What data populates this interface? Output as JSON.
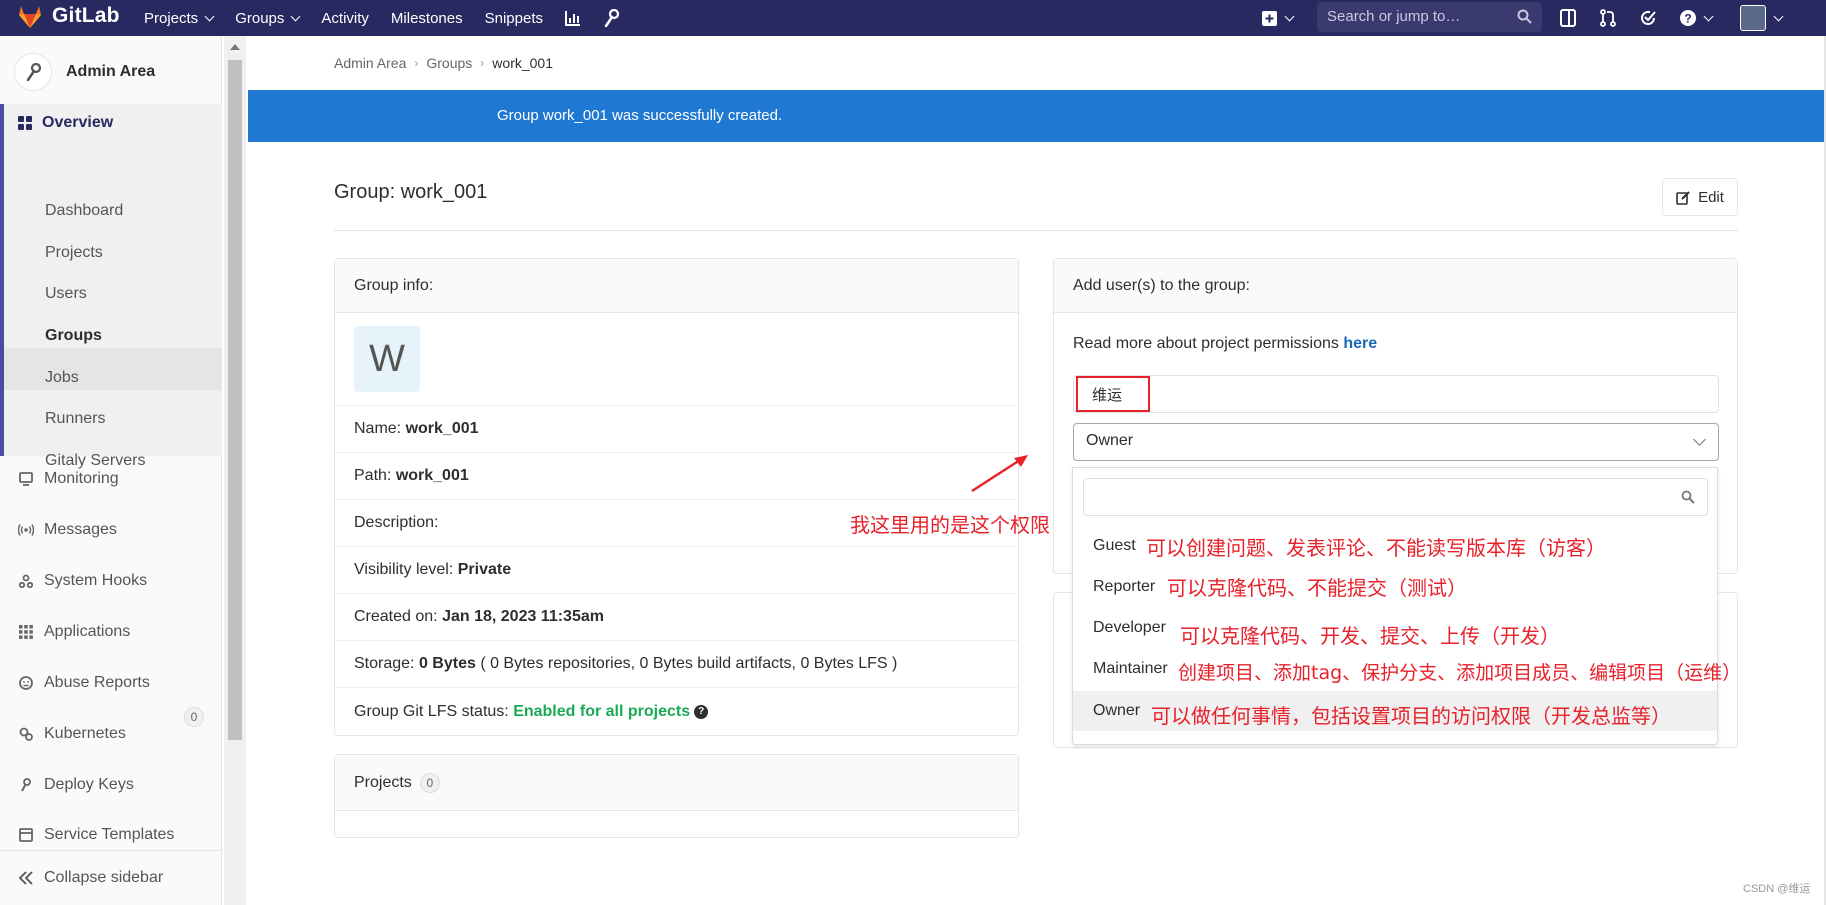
{
  "brand": {
    "name": "GitLab",
    "navbar_color": "#292961",
    "accent": "#1f78d1"
  },
  "nav": {
    "items": [
      {
        "label": "Projects",
        "dropdown": true
      },
      {
        "label": "Groups",
        "dropdown": true
      },
      {
        "label": "Activity",
        "dropdown": false
      },
      {
        "label": "Milestones",
        "dropdown": false
      },
      {
        "label": "Snippets",
        "dropdown": false
      }
    ],
    "search_placeholder": "Search or jump to…",
    "icons": [
      "chart-icon",
      "wrench-icon",
      "plus-square-icon",
      "search-icon",
      "sidebar-icon",
      "merge-request-icon",
      "todo-check-icon",
      "help-icon",
      "avatar"
    ]
  },
  "sidebar": {
    "title": "Admin Area",
    "overview": "Overview",
    "overview_items": [
      "Dashboard",
      "Projects",
      "Users",
      "Groups",
      "Jobs",
      "Runners",
      "Gitaly Servers"
    ],
    "active_item": "Groups",
    "items": [
      {
        "label": "Monitoring",
        "icon": "monitor-icon"
      },
      {
        "label": "Messages",
        "icon": "broadcast-icon"
      },
      {
        "label": "System Hooks",
        "icon": "hook-icon"
      },
      {
        "label": "Applications",
        "icon": "apps-grid-icon"
      },
      {
        "label": "Abuse Reports",
        "icon": "abuse-icon",
        "badge": "0"
      },
      {
        "label": "Kubernetes",
        "icon": "kubernetes-icon"
      },
      {
        "label": "Deploy Keys",
        "icon": "key-icon"
      },
      {
        "label": "Service Templates",
        "icon": "template-icon"
      }
    ],
    "collapse": "Collapse sidebar"
  },
  "breadcrumb": [
    "Admin Area",
    "Groups",
    "work_001"
  ],
  "flash": "Group work_001 was successfully created.",
  "page": {
    "title": "Group: work_001",
    "edit": "Edit"
  },
  "group_info": {
    "header": "Group info:",
    "avatar_letter": "W",
    "name_label": "Name:",
    "name": "work_001",
    "path_label": "Path:",
    "path": "work_001",
    "description_label": "Description:",
    "visibility_label": "Visibility level:",
    "visibility": "Private",
    "created_label": "Created on:",
    "created": "Jan 18, 2023 11:35am",
    "storage_label": "Storage:",
    "storage": "0 Bytes",
    "storage_detail": "( 0 Bytes repositories, 0 Bytes build artifacts, 0 Bytes LFS )",
    "lfs_label": "Group Git LFS status:",
    "lfs": "Enabled for all projects"
  },
  "projects": {
    "label": "Projects",
    "count": "0"
  },
  "add_users": {
    "header": "Add user(s) to the group:",
    "permissions_text": "Read more about project permissions",
    "permissions_link": "here",
    "user_token": "维运",
    "selected_role": "Owner",
    "options": [
      {
        "label": "Guest",
        "note": "可以创建问题、发表评论、不能读写版本库（访客）"
      },
      {
        "label": "Reporter",
        "note": "可以克隆代码、不能提交（测试）"
      },
      {
        "label": "Developer",
        "note": "可以克隆代码、开发、提交、上传（开发）"
      },
      {
        "label": "Maintainer",
        "note": "创建项目、添加tag、保护分支、添加项目成员、编辑项目（运维）"
      },
      {
        "label": "Owner",
        "note": "可以做任何事情，包括设置项目的访问权限（开发总监等）"
      }
    ]
  },
  "annotation": {
    "text": "我这里用的是这个权限",
    "color": "#e8212a"
  },
  "watermark": "CSDN @维运"
}
